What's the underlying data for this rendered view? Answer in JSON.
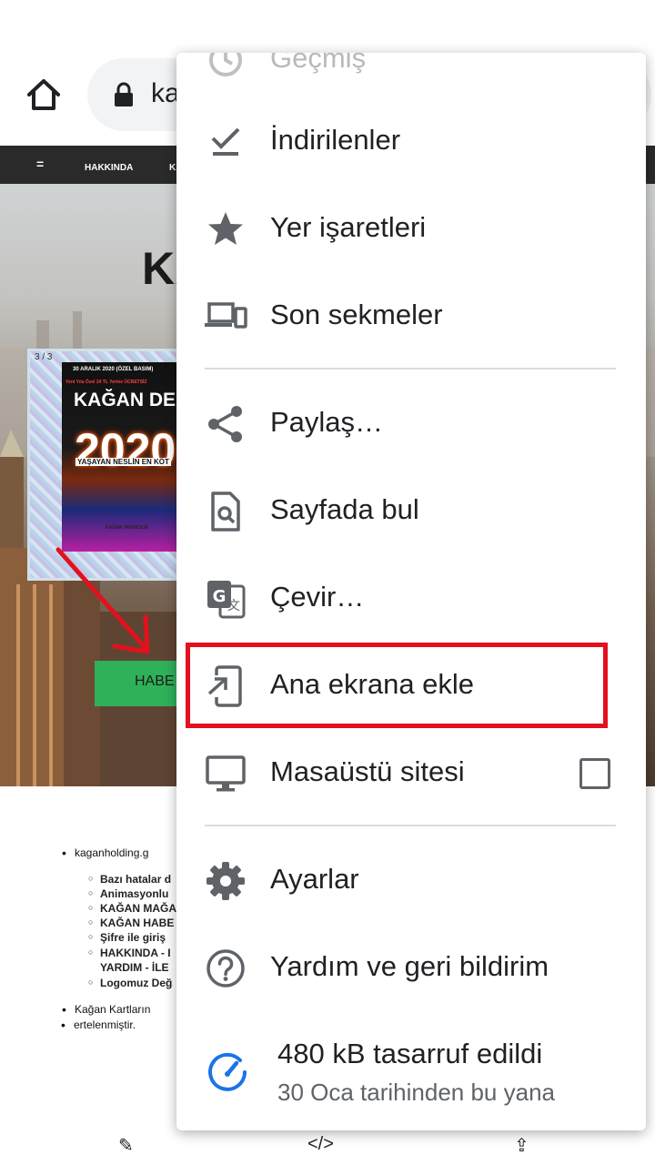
{
  "browser": {
    "url_text": "ka",
    "icons": {
      "home": "home-icon",
      "lock": "lock-icon"
    }
  },
  "site": {
    "nav": {
      "menu_glyph": "=",
      "items": [
        "HAKKINDA",
        "KA"
      ]
    },
    "hero_title": "KA",
    "promo": {
      "page_indicator": "3 / 3",
      "date_line": "30 ARALIK 2020        (ÖZEL BASIM)",
      "subtitle": "Yeni Yıla Özel 24 TL Yerine ÜCRETSİZ",
      "brand": "KAĞAN DER",
      "year": "2020",
      "tagline": "YAŞAYAN NESLİN EN KÖT",
      "publisher": "KAĞAN YAYINCILIK"
    },
    "cta_label": "HABE",
    "notes": {
      "main_1": "kaganholding.g",
      "subs": [
        "Bazı hatalar d",
        "Animasyonlu",
        "KAĞAN MAĞA",
        "KAĞAN HABE",
        "Şifre ile giriş",
        "HAKKINDA - I",
        "YARDIM - İLE",
        "Logomuz Değ"
      ],
      "main_2_line1": "Kağan Kartların",
      "main_2_line2": "ertelenmiştir."
    }
  },
  "bottom_bar": {
    "edit": "✎",
    "code": "</>",
    "share": "⇪"
  },
  "menu": {
    "top_partial": "Geçmiş",
    "items": [
      {
        "label": "İndirilenler",
        "icon": "download-done-icon"
      },
      {
        "label": "Yer işaretleri",
        "icon": "star-icon"
      },
      {
        "label": "Son sekmeler",
        "icon": "devices-icon"
      },
      {
        "label": "Paylaş…",
        "icon": "share-icon"
      },
      {
        "label": "Sayfada bul",
        "icon": "find-in-page-icon"
      },
      {
        "label": "Çevir…",
        "icon": "translate-icon"
      },
      {
        "label": "Ana ekrana ekle",
        "icon": "add-to-home-screen-icon"
      },
      {
        "label": "Masaüstü sitesi",
        "icon": "desktop-icon"
      },
      {
        "label": "Ayarlar",
        "icon": "settings-gear-icon"
      },
      {
        "label": "Yardım ve geri bildirim",
        "icon": "help-icon"
      }
    ],
    "desktop_site_checked": false,
    "data_saver": {
      "title": "480 kB tasarruf edildi",
      "subtitle": "30 Oca tarihinden bu yana",
      "icon": "speedometer-icon"
    }
  },
  "colors": {
    "menu_text": "#202124",
    "menu_icon": "#5f6368",
    "highlight": "#e3101e",
    "data_saver_icon": "#1a73e8",
    "site_nav": "#2a2a2a",
    "cta_green": "#2fb15a"
  }
}
